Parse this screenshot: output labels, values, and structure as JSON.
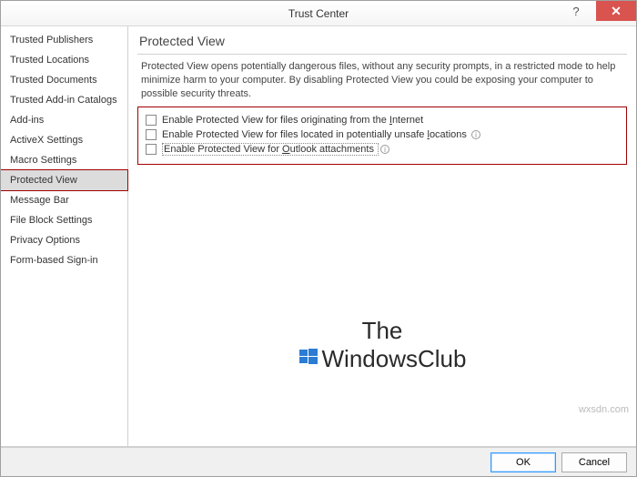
{
  "window": {
    "title": "Trust Center",
    "help_symbol": "?",
    "close_symbol": "✕"
  },
  "sidebar": {
    "items": [
      {
        "label": "Trusted Publishers"
      },
      {
        "label": "Trusted Locations"
      },
      {
        "label": "Trusted Documents"
      },
      {
        "label": "Trusted Add-in Catalogs"
      },
      {
        "label": "Add-ins"
      },
      {
        "label": "ActiveX Settings"
      },
      {
        "label": "Macro Settings"
      },
      {
        "label": "Protected View",
        "selected": true
      },
      {
        "label": "Message Bar"
      },
      {
        "label": "File Block Settings"
      },
      {
        "label": "Privacy Options"
      },
      {
        "label": "Form-based Sign-in"
      }
    ]
  },
  "content": {
    "section_title": "Protected View",
    "description": "Protected View opens potentially dangerous files, without any security prompts, in a restricted mode to help minimize harm to your computer. By disabling Protected View you could be exposing your computer to possible security threats.",
    "options": [
      {
        "pre": "Enable Protected View for files originating from the ",
        "hot": "I",
        "post": "nternet",
        "info": false
      },
      {
        "pre": "Enable Protected View for files located in potentially unsafe ",
        "hot": "l",
        "post": "ocations",
        "info": true
      },
      {
        "pre": "Enable Protected View for ",
        "hot": "O",
        "post": "utlook attachments",
        "info": true,
        "dotted": true
      }
    ]
  },
  "watermark": {
    "line1": "The",
    "line2": "WindowsClub"
  },
  "source_tag": "wxsdn.com",
  "footer": {
    "ok": "OK",
    "cancel": "Cancel"
  }
}
